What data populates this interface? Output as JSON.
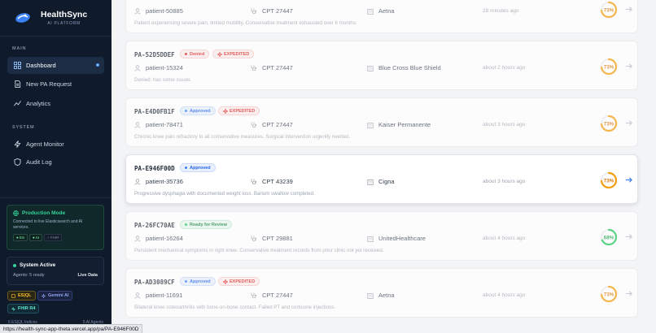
{
  "app": {
    "name": "HealthSync",
    "subtitle": "AI PLATFORM"
  },
  "sidebar": {
    "main_label": "MAIN",
    "system_label": "SYSTEM",
    "nav": [
      {
        "label": "Dashboard",
        "icon": "grid-icon",
        "active": true
      },
      {
        "label": "New PA Request",
        "icon": "document-icon"
      },
      {
        "label": "Analytics",
        "icon": "chart-icon"
      }
    ],
    "system_nav": [
      {
        "label": "Agent Monitor",
        "icon": "bolt-icon"
      },
      {
        "label": "Audit Log",
        "icon": "shield-icon"
      }
    ],
    "production": {
      "title": "Production Mode",
      "description": "Connected to live Elasticsearch and AI services.",
      "chips": [
        "ES",
        "AI",
        "FHIR"
      ]
    },
    "system_status": {
      "title": "System Active",
      "agents": "Agents: 5 ready",
      "live": "Live Data"
    },
    "badges": [
      "ES|QL",
      "Gemini AI",
      "FHIR R4"
    ],
    "footer_left": "6 ES|QL Indices",
    "footer_right": "5 AI Agents"
  },
  "requests": [
    {
      "id": "",
      "statuses": [],
      "patient": "patient-50885",
      "cpt": "CPT 27447",
      "payer": "Aetna",
      "time": "28 minutes ago",
      "note": "Patient experiencing severe pain, limited mobility. Conservative treatment exhausted over 6 months.",
      "score": 73,
      "score_label": "73%",
      "score_color": "#f59e0b"
    },
    {
      "id": "PA-52D5DDEF",
      "status": "Denied",
      "status_kind": "denied",
      "expedited": "EXPEDITED",
      "patient": "patient-15324",
      "cpt": "CPT 27447",
      "payer": "Blue Cross Blue Shield",
      "time": "about 2 hours ago",
      "note": "Denied: has some issues",
      "score": 73,
      "score_label": "73%",
      "score_color": "#f59e0b"
    },
    {
      "id": "PA-E4D0FB1F",
      "status": "Approved",
      "status_kind": "approved",
      "expedited": "EXPEDITED",
      "patient": "patient-78471",
      "cpt": "CPT 27447",
      "payer": "Kaiser Permanente",
      "time": "about 3 hours ago",
      "note": "Chronic knee pain refractory to all conservative measures. Surgical intervention urgently needed.",
      "score": 73,
      "score_label": "73%",
      "score_color": "#f59e0b"
    },
    {
      "id": "PA-E946F00D",
      "status": "Approved",
      "status_kind": "approved",
      "expedited": "",
      "patient": "patient-35736",
      "cpt": "CPT 43239",
      "payer": "Cigna",
      "time": "about 3 hours ago",
      "note": "Progressive dysphagia with documented weight loss. Barium swallow completed.",
      "score": 73,
      "score_label": "73%",
      "score_color": "#f59e0b"
    },
    {
      "id": "PA-26FC70AE",
      "status": "Ready for Review",
      "status_kind": "review",
      "expedited": "",
      "patient": "patient-16264",
      "cpt": "CPT 29881",
      "payer": "UnitedHealthcare",
      "time": "about 4 hours ago",
      "note": "Persistent mechanical symptoms in right knee. Conservative treatment records from prior clinic not yet received.",
      "score": 68,
      "score_label": "68%",
      "score_color": "#22c55e"
    },
    {
      "id": "PA-AD3089CF",
      "status": "Approved",
      "status_kind": "approved",
      "expedited": "EXPEDITED",
      "patient": "patient-11691",
      "cpt": "CPT 27447",
      "payer": "Aetna",
      "time": "about 4 hours ago",
      "note": "Bilateral knee osteoarthritis with bone-on-bone contact. Failed PT and cortisone injections.",
      "score": 73,
      "score_label": "73%",
      "score_color": "#f59e0b"
    }
  ],
  "status_bar": {
    "url": "https://health-sync-app-theta.vercel.app/pa/PA-E946F00D"
  }
}
